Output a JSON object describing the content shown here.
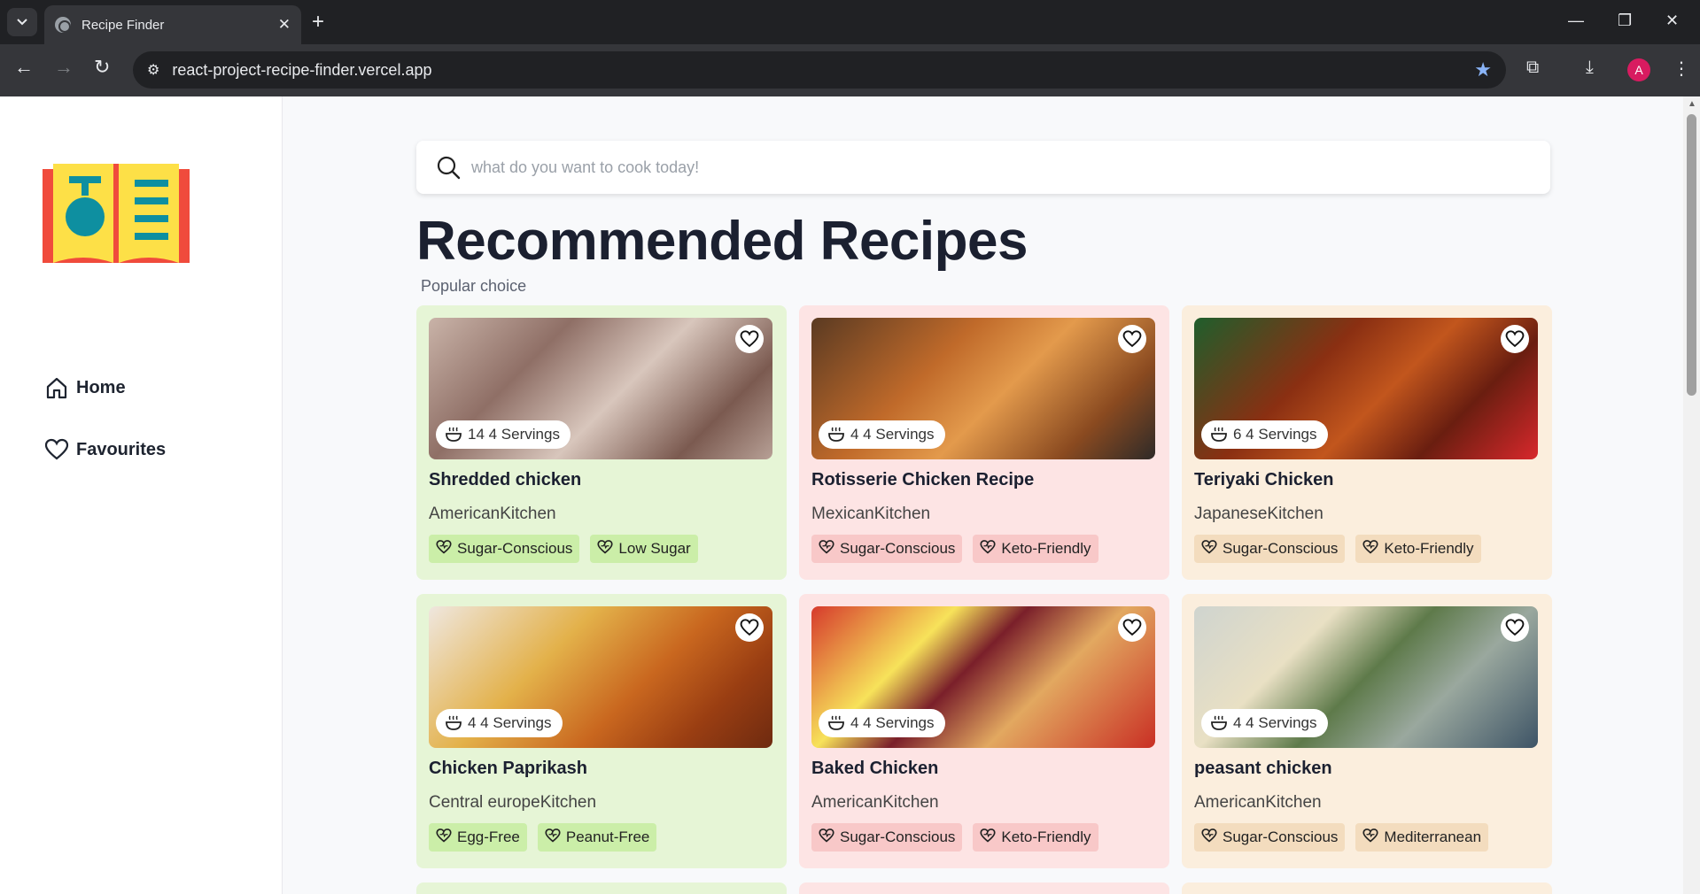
{
  "browser": {
    "tab_title": "Recipe Finder",
    "url": "react-project-recipe-finder.vercel.app",
    "avatar_letter": "A"
  },
  "sidebar": {
    "logo_icon": "recipe-book-logo",
    "items": [
      {
        "label": "Home",
        "icon": "home-icon"
      },
      {
        "label": "Favourites",
        "icon": "heart-icon"
      }
    ]
  },
  "search": {
    "placeholder": "what do you want to cook today!"
  },
  "header": {
    "title": "Recommended Recipes",
    "subtitle": "Popular choice"
  },
  "recipes": [
    {
      "name": "Shredded chicken",
      "servings": "14 4 Servings",
      "kitchen": "AmericanKitchen",
      "tags": [
        "Sugar-Conscious",
        "Low Sugar"
      ],
      "theme": "green"
    },
    {
      "name": "Rotisserie Chicken Recipe",
      "servings": "4 4 Servings",
      "kitchen": "MexicanKitchen",
      "tags": [
        "Sugar-Conscious",
        "Keto-Friendly"
      ],
      "theme": "pink"
    },
    {
      "name": "Teriyaki Chicken",
      "servings": "6 4 Servings",
      "kitchen": "JapaneseKitchen",
      "tags": [
        "Sugar-Conscious",
        "Keto-Friendly"
      ],
      "theme": "peach"
    },
    {
      "name": "Chicken Paprikash",
      "servings": "4 4 Servings",
      "kitchen": "Central europeKitchen",
      "tags": [
        "Egg-Free",
        "Peanut-Free"
      ],
      "theme": "green"
    },
    {
      "name": "Baked Chicken",
      "servings": "4 4 Servings",
      "kitchen": "AmericanKitchen",
      "tags": [
        "Sugar-Conscious",
        "Keto-Friendly"
      ],
      "theme": "pink"
    },
    {
      "name": "peasant chicken",
      "servings": "4 4 Servings",
      "kitchen": "AmericanKitchen",
      "tags": [
        "Sugar-Conscious",
        "Mediterranean"
      ],
      "theme": "peach"
    }
  ],
  "colors": {
    "card_green": "#e6f5d6",
    "card_pink": "#fde4e4",
    "card_peach": "#fbeedd",
    "logo_red": "#f04b3c",
    "logo_yellow": "#fde047",
    "logo_teal": "#0e8fa0"
  }
}
